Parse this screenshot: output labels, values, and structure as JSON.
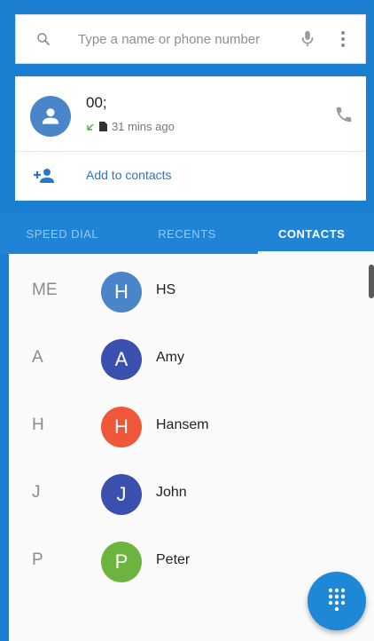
{
  "colors": {
    "primary": "#1a7fd1",
    "tab_bar": "#1f83d6",
    "fab": "#1e88d6"
  },
  "search": {
    "placeholder": "Type a name or phone number",
    "icons": [
      "search-icon",
      "mic-icon",
      "more-vert-icon"
    ]
  },
  "recent_call": {
    "name": "00;",
    "time": "31 mins ago",
    "add_label": "Add to contacts",
    "icons": [
      "person-icon",
      "call-icon",
      "add-contact-icon"
    ]
  },
  "tabs": [
    {
      "label": "SPEED DIAL",
      "active": false
    },
    {
      "label": "RECENTS",
      "active": false
    },
    {
      "label": "CONTACTS",
      "active": true
    }
  ],
  "contacts": [
    {
      "section": "ME",
      "initial": "H",
      "name": "HS",
      "color": "#4a84c9"
    },
    {
      "section": "A",
      "initial": "A",
      "name": "Amy",
      "color": "#3b4fae"
    },
    {
      "section": "H",
      "initial": "H",
      "name": "Hansem",
      "color": "#f0563a"
    },
    {
      "section": "J",
      "initial": "J",
      "name": "John",
      "color": "#3b4fae"
    },
    {
      "section": "P",
      "initial": "P",
      "name": "Peter",
      "color": "#6db33f"
    }
  ],
  "fab": {
    "icon": "dialpad-icon"
  }
}
